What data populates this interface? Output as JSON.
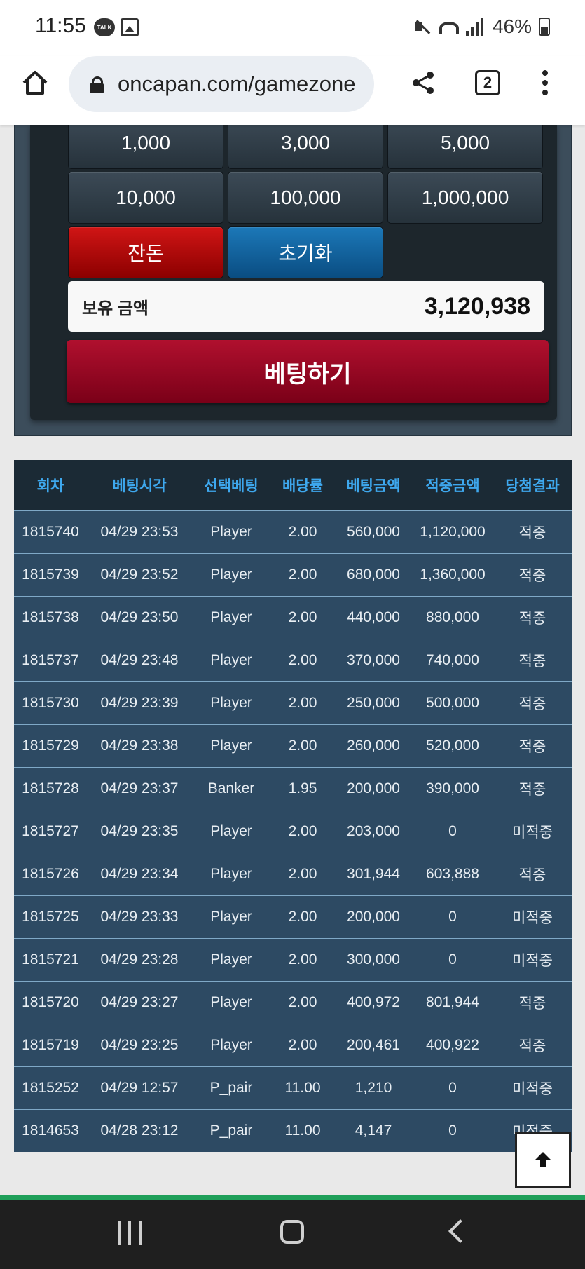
{
  "status_bar": {
    "time": "11:55",
    "talk_badge": "TALK",
    "battery": "46%"
  },
  "browser": {
    "url": "oncapan.com/gamezone",
    "tab_count": "2"
  },
  "bet_panel": {
    "chips": [
      "1,000",
      "3,000",
      "5,000",
      "10,000",
      "100,000",
      "1,000,000"
    ],
    "change_label": "잔돈",
    "reset_label": "초기화",
    "balance_label": "보유 금액",
    "balance_value": "3,120,938",
    "submit_label": "베팅하기"
  },
  "history": {
    "headers": [
      "회차",
      "베팅시각",
      "선택베팅",
      "배당률",
      "베팅금액",
      "적중금액",
      "당첨결과"
    ],
    "rows": [
      [
        "1815740",
        "04/29 23:53",
        "Player",
        "2.00",
        "560,000",
        "1,120,000",
        "적중"
      ],
      [
        "1815739",
        "04/29 23:52",
        "Player",
        "2.00",
        "680,000",
        "1,360,000",
        "적중"
      ],
      [
        "1815738",
        "04/29 23:50",
        "Player",
        "2.00",
        "440,000",
        "880,000",
        "적중"
      ],
      [
        "1815737",
        "04/29 23:48",
        "Player",
        "2.00",
        "370,000",
        "740,000",
        "적중"
      ],
      [
        "1815730",
        "04/29 23:39",
        "Player",
        "2.00",
        "250,000",
        "500,000",
        "적중"
      ],
      [
        "1815729",
        "04/29 23:38",
        "Player",
        "2.00",
        "260,000",
        "520,000",
        "적중"
      ],
      [
        "1815728",
        "04/29 23:37",
        "Banker",
        "1.95",
        "200,000",
        "390,000",
        "적중"
      ],
      [
        "1815727",
        "04/29 23:35",
        "Player",
        "2.00",
        "203,000",
        "0",
        "미적중"
      ],
      [
        "1815726",
        "04/29 23:34",
        "Player",
        "2.00",
        "301,944",
        "603,888",
        "적중"
      ],
      [
        "1815725",
        "04/29 23:33",
        "Player",
        "2.00",
        "200,000",
        "0",
        "미적중"
      ],
      [
        "1815721",
        "04/29 23:28",
        "Player",
        "2.00",
        "300,000",
        "0",
        "미적중"
      ],
      [
        "1815720",
        "04/29 23:27",
        "Player",
        "2.00",
        "400,972",
        "801,944",
        "적중"
      ],
      [
        "1815719",
        "04/29 23:25",
        "Player",
        "2.00",
        "200,461",
        "400,922",
        "적중"
      ],
      [
        "1815252",
        "04/29 12:57",
        "P_pair",
        "11.00",
        "1,210",
        "0",
        "미적중"
      ],
      [
        "1814653",
        "04/28 23:12",
        "P_pair",
        "11.00",
        "4,147",
        "0",
        "미적중"
      ]
    ]
  }
}
